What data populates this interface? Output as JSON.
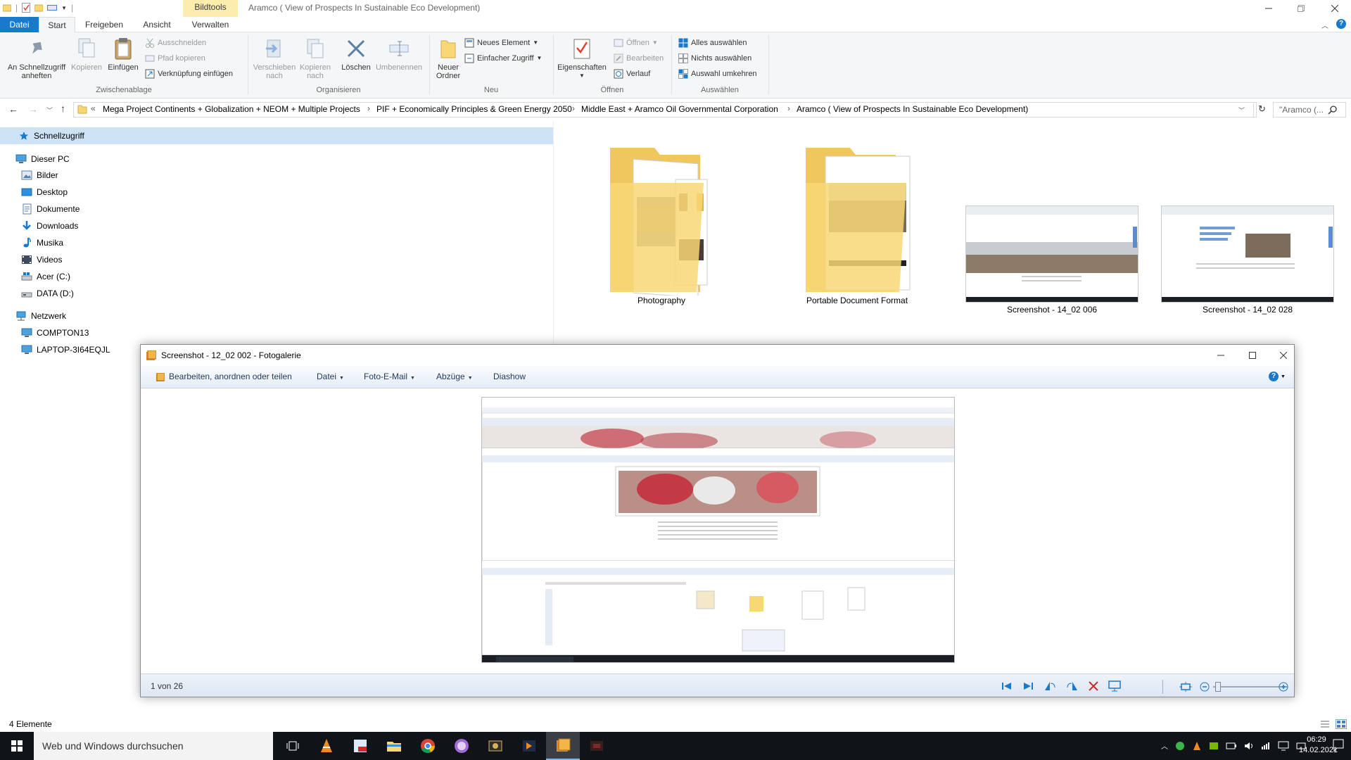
{
  "explorer": {
    "window_title": "Aramco ( View of Prospects In Sustainable Eco Development)",
    "bildtools_label": "Bildtools",
    "tabs": [
      "Datei",
      "Start",
      "Freigeben",
      "Ansicht",
      "Verwalten"
    ],
    "ribbon": {
      "pin_label": "An Schnellzugriff\nanheften",
      "copy_label": "Kopieren",
      "paste_label": "Einfügen",
      "cut_label": "Ausschneiden",
      "copy_path_label": "Pfad kopieren",
      "paste_shortcut_label": "Verknüpfung einfügen",
      "group_clipboard": "Zwischenablage",
      "move_to_label": "Verschieben\nnach",
      "copy_to_label": "Kopieren\nnach",
      "delete_label": "Löschen",
      "rename_label": "Umbenennen",
      "group_organize": "Organisieren",
      "new_folder_label": "Neuer\nOrdner",
      "new_item_label": "Neues Element",
      "easy_access_label": "Einfacher Zugriff",
      "group_new": "Neu",
      "properties_label": "Eigenschaften",
      "open_label": "Öffnen",
      "edit_label": "Bearbeiten",
      "history_label": "Verlauf",
      "group_open": "Öffnen",
      "select_all_label": "Alles auswählen",
      "select_none_label": "Nichts auswählen",
      "invert_selection_label": "Auswahl umkehren",
      "group_select": "Auswählen"
    },
    "address": {
      "prefix": "«",
      "crumbs": [
        "Mega Project Continents + Globalization + NEOM + Multiple Projects",
        "PIF + Economically Principles & Green Energy 2050",
        "Middle East  + Aramco Oil Governmental Corporation",
        "Aramco ( View of Prospects In Sustainable Eco Development)"
      ],
      "search_placeholder": "\"Aramco (..."
    },
    "nav": {
      "quick_access": "Schnellzugriff",
      "this_pc": "Dieser PC",
      "pc_items": [
        "Bilder",
        "Desktop",
        "Dokumente",
        "Downloads",
        "Musika",
        "Videos",
        "Acer (C:)",
        "DATA (D:)"
      ],
      "network": "Netzwerk",
      "network_items": [
        "COMPTON13",
        "LAPTOP-3I64EQJL"
      ]
    },
    "items": [
      "Photography",
      "Portable Document Format",
      "Screenshot - 14_02 006",
      "Screenshot - 14_02 028"
    ],
    "status_count": "4 Elemente"
  },
  "gallery": {
    "title": "Screenshot - 12_02 002 - Fotogalerie",
    "toolbar": [
      "Bearbeiten, anordnen oder teilen",
      "Datei",
      "Foto-E-Mail",
      "Abzüge",
      "Diashow"
    ],
    "position": "1 von 26"
  },
  "taskbar": {
    "search_placeholder": "Web und Windows durchsuchen",
    "time": "06:29",
    "date": "14.02.2021"
  },
  "colors": {
    "accent": "#1979ca",
    "selection": "#cde3f5",
    "folder": "#f8d775",
    "taskbar": "#101418"
  }
}
